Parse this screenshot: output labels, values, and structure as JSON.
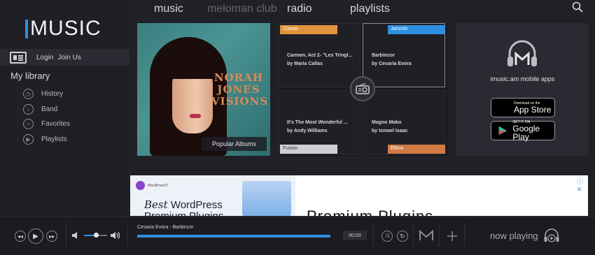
{
  "logo": {
    "text": "MUSIC"
  },
  "auth": {
    "login": "Login",
    "join": "Join Us"
  },
  "library": {
    "title": "My library",
    "items": [
      {
        "label": "History",
        "icon": "history-icon"
      },
      {
        "label": "Band",
        "icon": "band-icon"
      },
      {
        "label": "Favorites",
        "icon": "star-icon"
      },
      {
        "label": "Playlists",
        "icon": "play-icon"
      }
    ]
  },
  "nav": {
    "items": [
      "music",
      "meloman club",
      "radio",
      "playlists"
    ]
  },
  "popular": {
    "caption": "Popular Albums",
    "album_title": "NORAH JONES VISIONS"
  },
  "genres": [
    {
      "tag": "Classic",
      "color": "#e0933a",
      "line1": "Carmen, Act 2- \"Les Tringl...",
      "line2": "by Maria Callas"
    },
    {
      "tag": "Jammin",
      "color": "#2e8fe0",
      "line1": "Barbincor",
      "line2": "by Cesaria Evora"
    },
    {
      "tag": "Fusion",
      "color": "#d0d0d4",
      "line1": "It's The Most Wonderful ...",
      "line2": "by Andy Williams"
    },
    {
      "tag": "Ethno",
      "color": "#d27a43",
      "line1": "Magno Mako",
      "line2": "by Ismael Isaac"
    }
  ],
  "apps": {
    "label": "imusic.am mobile apps",
    "appstore_small": "Download on the",
    "appstore_big": "App Store",
    "google_small": "GET IT ON",
    "google_big": "Google Play"
  },
  "ad": {
    "brand": "WordPressIT",
    "line1_italic": "Best",
    "line1": "WordPress",
    "line2": "Premium Plugins",
    "big": "Premium Plugins",
    "close": "ⓘ ✕"
  },
  "player": {
    "track": "Cesaria Evora - Barbincor",
    "time": "00:00",
    "now_playing": "now playing",
    "progress": 1.0,
    "volume": 0.5
  }
}
